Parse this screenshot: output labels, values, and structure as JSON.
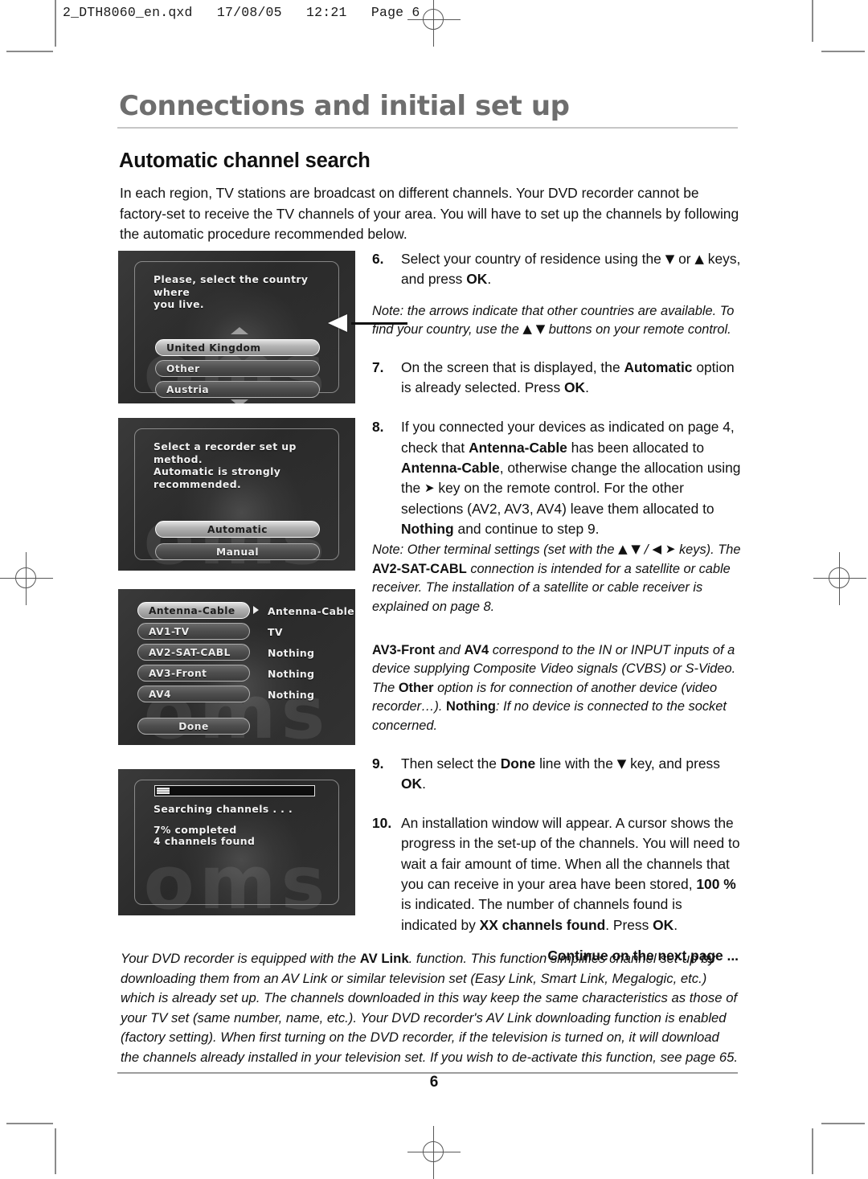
{
  "file_header": {
    "text": "2_DTH8060_en.qxd   17/08/05   12:21   Page 6"
  },
  "header": {
    "chapter_title": "Connections and initial set up",
    "section_title": "Automatic channel search"
  },
  "intro": {
    "paragraph": "In each region, TV stations are broadcast on different channels. Your DVD recorder cannot be factory-set to receive the TV channels of your area. You will have to set up the channels by following the automatic procedure recommended below."
  },
  "screenshots": [
    {
      "name": "country-select",
      "message": "Please, select the country where\nyou live.",
      "options": [
        "United Kingdom",
        "Other",
        "Austria"
      ],
      "selected": "United Kingdom",
      "ghost_text": "oms"
    },
    {
      "name": "setup-method",
      "message": "Select a recorder set up method.\nAutomatic is strongly\nrecommended.",
      "options": [
        "Automatic",
        "Manual"
      ],
      "selected": "Automatic",
      "ghost_text": "oms"
    },
    {
      "name": "terminal-allocation",
      "rows": [
        {
          "terminal": "Antenna-Cable",
          "allocation": "Antenna-Cable"
        },
        {
          "terminal": "AV1-TV",
          "allocation": "TV"
        },
        {
          "terminal": "AV2-SAT-CABL",
          "allocation": "Nothing"
        },
        {
          "terminal": "AV3-Front",
          "allocation": "Nothing"
        },
        {
          "terminal": "AV4",
          "allocation": "Nothing"
        }
      ],
      "selected": "Antenna-Cable",
      "done_label": "Done",
      "ghost_text": "oms"
    },
    {
      "name": "searching-channels",
      "status": "Searching channels . . .",
      "progress_text": "7% completed",
      "found_text": "4 channels found",
      "progress_percent": 7,
      "ghost_text": "oms"
    }
  ],
  "steps": {
    "step6": {
      "number": "6.",
      "text_before": "Select your country of residence using the ",
      "arrow1": "▼",
      "text_mid": " or ",
      "arrow2": "▲",
      "text_after": " keys, and press ",
      "bold_ok": "OK",
      "period": "."
    },
    "note6": {
      "line1": "Note: the arrows indicate that other countries are available.",
      "line2_before": "To find your country, use the ",
      "arrows": "▲ ▼",
      "line2_after": " buttons on your remote control."
    },
    "step7": {
      "number": "7.",
      "text_before": "On the screen that is displayed, the ",
      "bold1": "Automatic",
      "text_mid": " option is already selected. Press ",
      "bold_ok": "OK",
      "period": "."
    },
    "step8": {
      "number": "8.",
      "t1": "If you connected your devices as indicated on page 4, check that ",
      "b1": "Antenna-Cable",
      "t2": " has been allocated to ",
      "b2": "Antenna-Cable",
      "t3": ", otherwise change the allocation using the ",
      "arrow": "➤",
      "t4": " key on the remote control. For the other selections (AV2, AV3, AV4) leave them allocated to ",
      "b3": "Nothing",
      "t5": " and continue to step 9."
    },
    "note8": {
      "l1_before": "Note: Other terminal settings (set with the ",
      "l1_arrows": "▲ ▼ / ◀ ➤",
      "l1_after": " keys).",
      "l2_before": "The ",
      "l2_bold": "AV2-SAT-CABL",
      "l2_after": " connection is intended for a satellite or cable receiver. The installation of a satellite or cable receiver is explained on page 8.",
      "l3_b1": "AV3-Front",
      "l3_t1": " and ",
      "l3_b2": "AV4",
      "l3_t2": " correspond to the IN or INPUT inputs of a device supplying Composite Video signals (CVBS) or S-Video. The ",
      "l3_b3": "Other",
      "l3_t3": " option is for connection of another device (video recorder…).",
      "l4_bold": "Nothing",
      "l4_text": ": If no device is connected to the socket concerned."
    },
    "step9": {
      "number": "9.",
      "t1": "Then select the ",
      "b1": "Done",
      "t2": " line with the ",
      "arrow": "▼",
      "t3": " key, and press ",
      "b2": "OK",
      "t4": "."
    },
    "step10": {
      "number": "10.",
      "t1": "An installation window will appear. A cursor shows the progress in the set-up of the channels. You will need to wait a fair amount of time. When all the channels that you can receive in your area have been stored, ",
      "b1": "100 %",
      "t2": " is indicated. The number of channels found is indicated by ",
      "b2": "XX channels found",
      "t3": ". Press ",
      "b3": "OK",
      "t4": "."
    },
    "continue": "Continue on the next page ..."
  },
  "footnote": {
    "t1": "Your DVD recorder is equipped with the ",
    "b1": "AV Link",
    "t2": ". function. This function simplifies channel set-up by downloading them from an AV Link or similar television set (Easy Link, Smart Link, Megalogic, etc.) which is already set up. The channels downloaded in this way keep the same characteristics as those of your TV set (same number, name, etc.). Your DVD recorder's AV Link downloading function is enabled (factory setting). When first turning on the DVD recorder, if the television is turned on, it will download the channels already installed in your television set. If you wish to de-activate this function, see page 65."
  },
  "footer": {
    "page_number": "6"
  }
}
